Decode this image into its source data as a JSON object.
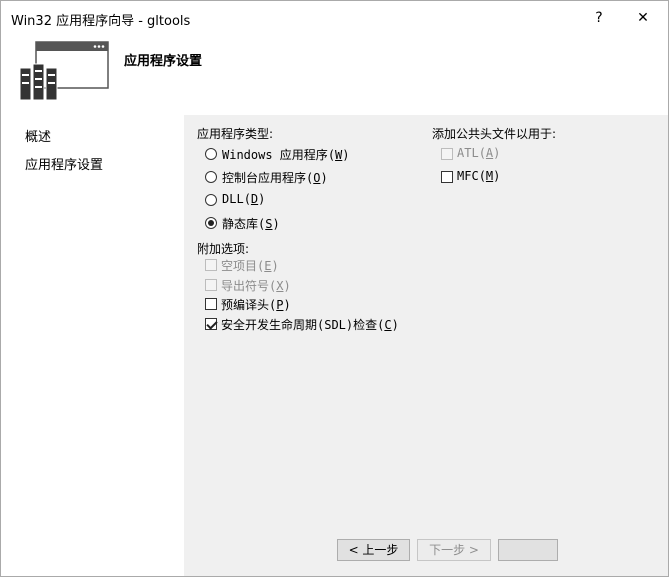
{
  "window": {
    "title": "Win32 应用程序向导 - gltools",
    "help_label": "?",
    "close_label": "✕"
  },
  "header": {
    "title": "应用程序设置"
  },
  "sidebar": {
    "items": [
      {
        "label": "概述"
      },
      {
        "label": "应用程序设置"
      }
    ]
  },
  "app_type": {
    "label": "应用程序类型:",
    "options": [
      {
        "label": "Windows 应用程序",
        "key": "W",
        "selected": false
      },
      {
        "label": "控制台应用程序",
        "key": "O",
        "selected": false
      },
      {
        "label": "DLL",
        "key": "D",
        "selected": false
      },
      {
        "label": "静态库",
        "key": "S",
        "selected": true
      }
    ]
  },
  "extra_options": {
    "label": "附加选项:",
    "options": [
      {
        "label": "空项目",
        "key": "E",
        "checked": false,
        "enabled": false
      },
      {
        "label": "导出符号",
        "key": "X",
        "checked": false,
        "enabled": false
      },
      {
        "label": "预编译头",
        "key": "P",
        "checked": false,
        "enabled": true
      },
      {
        "label": "安全开发生命周期(SDL)检查",
        "key": "C",
        "checked": true,
        "enabled": true
      }
    ]
  },
  "common_headers": {
    "label": "添加公共头文件以用于:",
    "options": [
      {
        "label": "ATL",
        "key": "A",
        "checked": false,
        "enabled": false
      },
      {
        "label": "MFC",
        "key": "M",
        "checked": false,
        "enabled": true
      }
    ]
  },
  "footer": {
    "prev_label": "< 上一步",
    "next_label": "下一步 >"
  },
  "icons": [
    "window-graphic-icon",
    "server-stack-icon",
    "help-icon",
    "close-icon"
  ]
}
